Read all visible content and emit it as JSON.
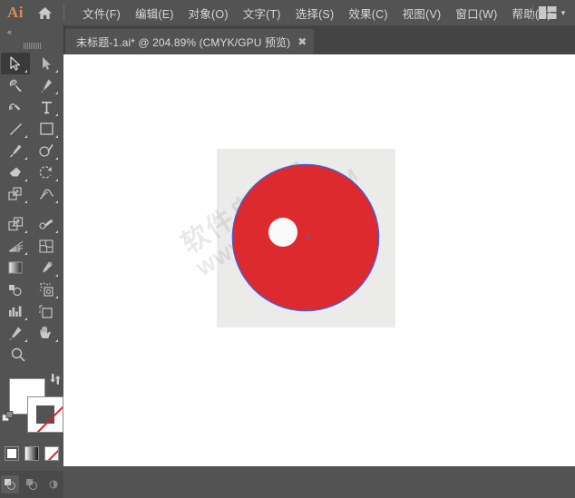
{
  "app": {
    "name": "Adobe Illustrator",
    "logo_text": "Ai",
    "theme_bg": "#535353",
    "panel_bg": "#444444"
  },
  "menubar": {
    "home_icon": "home-icon",
    "items": [
      {
        "label": "文件(F)"
      },
      {
        "label": "编辑(E)"
      },
      {
        "label": "对象(O)"
      },
      {
        "label": "文字(T)"
      },
      {
        "label": "选择(S)"
      },
      {
        "label": "效果(C)"
      },
      {
        "label": "视图(V)"
      },
      {
        "label": "窗口(W)"
      },
      {
        "label": "帮助(H)"
      }
    ],
    "workspace_icon": "workspace-layout-icon",
    "chevron": "▾"
  },
  "tabbar": {
    "tabs": [
      {
        "title": "未标题-1.ai* @ 204.89% (CMYK/GPU 预览)",
        "close_label": "✖",
        "active": true
      }
    ]
  },
  "toolpanel": {
    "collapse_label": "«",
    "tools": [
      {
        "name": "selection-tool",
        "selected": true,
        "has_flyout": true
      },
      {
        "name": "direct-selection-tool",
        "selected": false,
        "has_flyout": true
      },
      {
        "name": "magic-wand-tool",
        "selected": false,
        "has_flyout": false
      },
      {
        "name": "pen-tool",
        "selected": false,
        "has_flyout": true
      },
      {
        "name": "curvature-tool",
        "selected": false,
        "has_flyout": false
      },
      {
        "name": "type-tool",
        "selected": false,
        "has_flyout": true
      },
      {
        "name": "line-segment-tool",
        "selected": false,
        "has_flyout": true
      },
      {
        "name": "rectangle-tool",
        "selected": false,
        "has_flyout": true
      },
      {
        "name": "paintbrush-tool",
        "selected": false,
        "has_flyout": true
      },
      {
        "name": "shaper-tool",
        "selected": false,
        "has_flyout": true
      },
      {
        "name": "eraser-tool",
        "selected": false,
        "has_flyout": true
      },
      {
        "name": "rotate-tool",
        "selected": false,
        "has_flyout": true
      },
      {
        "name": "scale-tool",
        "selected": false,
        "has_flyout": true
      },
      {
        "name": "width-tool",
        "selected": false,
        "has_flyout": true
      },
      {
        "name": "free-transform-tool",
        "selected": false,
        "has_flyout": false
      },
      {
        "name": "shape-builder-tool",
        "selected": false,
        "has_flyout": true
      },
      {
        "name": "perspective-grid-tool",
        "selected": false,
        "has_flyout": true
      },
      {
        "name": "mesh-tool",
        "selected": false,
        "has_flyout": false
      },
      {
        "name": "gradient-tool",
        "selected": false,
        "has_flyout": false
      },
      {
        "name": "eyedropper-tool",
        "selected": false,
        "has_flyout": true
      },
      {
        "name": "blend-tool",
        "selected": false,
        "has_flyout": false
      },
      {
        "name": "symbol-sprayer-tool",
        "selected": false,
        "has_flyout": true
      },
      {
        "name": "column-graph-tool",
        "selected": false,
        "has_flyout": true
      },
      {
        "name": "artboard-tool",
        "selected": false,
        "has_flyout": false
      },
      {
        "name": "slice-tool",
        "selected": false,
        "has_flyout": true
      },
      {
        "name": "hand-tool",
        "selected": false,
        "has_flyout": true
      },
      {
        "name": "zoom-tool",
        "selected": false,
        "has_flyout": false
      }
    ],
    "color": {
      "fill_label": "fill-swatch",
      "fill_color": "#ffffff",
      "stroke_label": "stroke-swatch",
      "stroke_color": "none",
      "swap_label": "swap-fill-stroke-icon",
      "default_label": "default-fill-stroke-icon"
    },
    "paint_modes": [
      {
        "name": "color-mode-button",
        "kind": "color",
        "active": true
      },
      {
        "name": "gradient-mode-button",
        "kind": "gradient",
        "active": false
      },
      {
        "name": "none-mode-button",
        "kind": "none",
        "active": false
      }
    ],
    "draw_modes": [
      {
        "name": "draw-normal-button",
        "active": true
      },
      {
        "name": "draw-behind-button",
        "active": false
      },
      {
        "name": "draw-inside-button",
        "active": false
      }
    ]
  },
  "canvas": {
    "zoom_level": "204.89%",
    "color_mode": "CMYK",
    "preview_mode": "GPU 预览",
    "artboard_color": "#ebebe9",
    "watermark": {
      "line1": "软件自学网",
      "line2": "WWW.RJZXW.COM"
    },
    "shapes": [
      {
        "name": "red-circle",
        "type": "ellipse",
        "fill": "#dd2a2e",
        "selected": true,
        "selection_color": "#3f5fe0"
      },
      {
        "name": "white-circle",
        "type": "ellipse",
        "fill": "#fafafa",
        "selected": false
      }
    ],
    "anchor_marker": {
      "name": "center-anchor-point",
      "glyph": "×",
      "color": "#2f6fe0"
    }
  }
}
